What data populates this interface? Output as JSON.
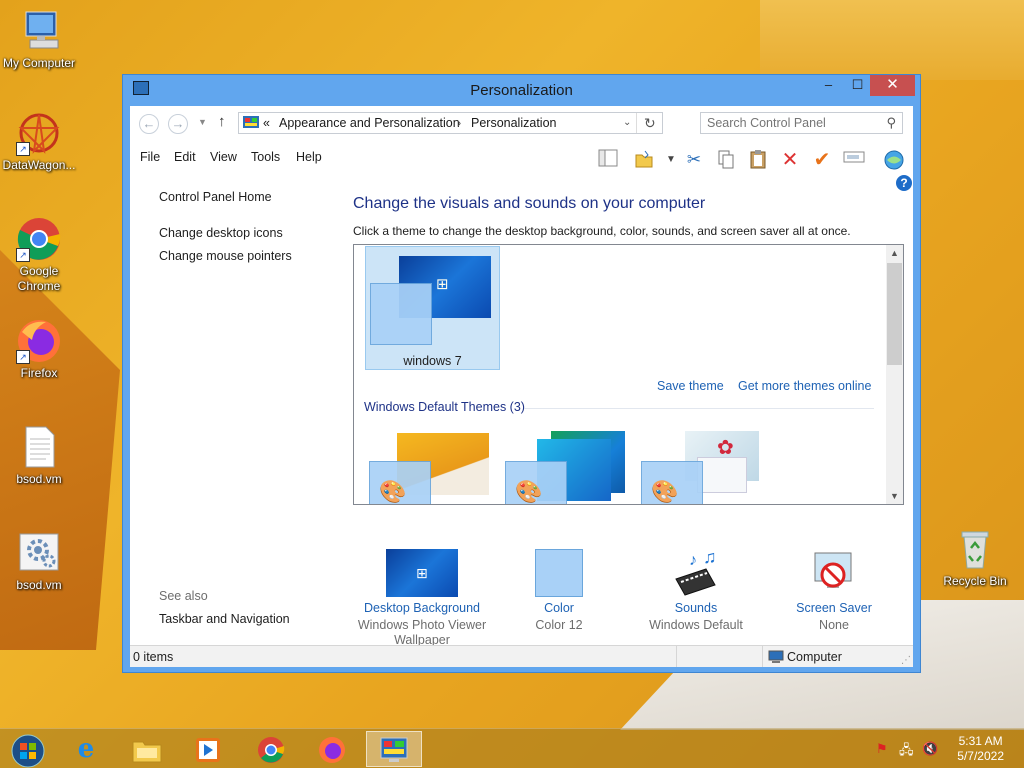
{
  "desktop": {
    "icons": [
      {
        "label": "My Computer",
        "icon": "computer-icon"
      },
      {
        "label": "DataWagon...",
        "icon": "datawagon-icon"
      },
      {
        "label": "Google Chrome",
        "icon": "chrome-icon"
      },
      {
        "label": "Firefox",
        "icon": "firefox-icon"
      },
      {
        "label": "bsod.vm",
        "icon": "document-icon"
      },
      {
        "label": "bsod.vm",
        "icon": "vm-settings-icon"
      },
      {
        "label": "Recycle Bin",
        "icon": "recycle-bin-icon"
      }
    ]
  },
  "window": {
    "title": "Personalization",
    "controls": {
      "minimize": "–",
      "maximize": "☐",
      "close": "✕"
    }
  },
  "address": {
    "prefix": "«",
    "crumbs": [
      "Appearance and Personalization",
      "Personalization"
    ],
    "separator": "›"
  },
  "search": {
    "placeholder": "Search Control Panel"
  },
  "menu": [
    "File",
    "Edit",
    "View",
    "Tools",
    "Help"
  ],
  "left_pane": {
    "links": [
      "Control Panel Home",
      "Change desktop icons",
      "Change mouse pointers"
    ],
    "see_also_heading": "See also",
    "see_also_links": [
      "Taskbar and Navigation"
    ]
  },
  "main": {
    "title": "Change the visuals and sounds on your computer",
    "description": "Click a theme to change the desktop background, color, sounds, and screen saver all at once.",
    "my_theme": {
      "label": "windows 7"
    },
    "save_theme": "Save theme",
    "get_more": "Get more themes online",
    "group_heading": "Windows Default Themes (3)"
  },
  "settings": [
    {
      "link": "Desktop Background",
      "sub": "Windows Photo Viewer Wallpaper"
    },
    {
      "link": "Color",
      "sub": "Color 12"
    },
    {
      "link": "Sounds",
      "sub": "Windows Default"
    },
    {
      "link": "Screen Saver",
      "sub": "None"
    }
  ],
  "status": {
    "items": "0 items",
    "location": "Computer"
  },
  "taskbar": {
    "time": "5:31 AM",
    "date": "5/7/2022"
  },
  "colors": {
    "accent": "#61a6ee",
    "link": "#1e62b4",
    "title_blue": "#1e3287",
    "close_red": "#c75050"
  }
}
